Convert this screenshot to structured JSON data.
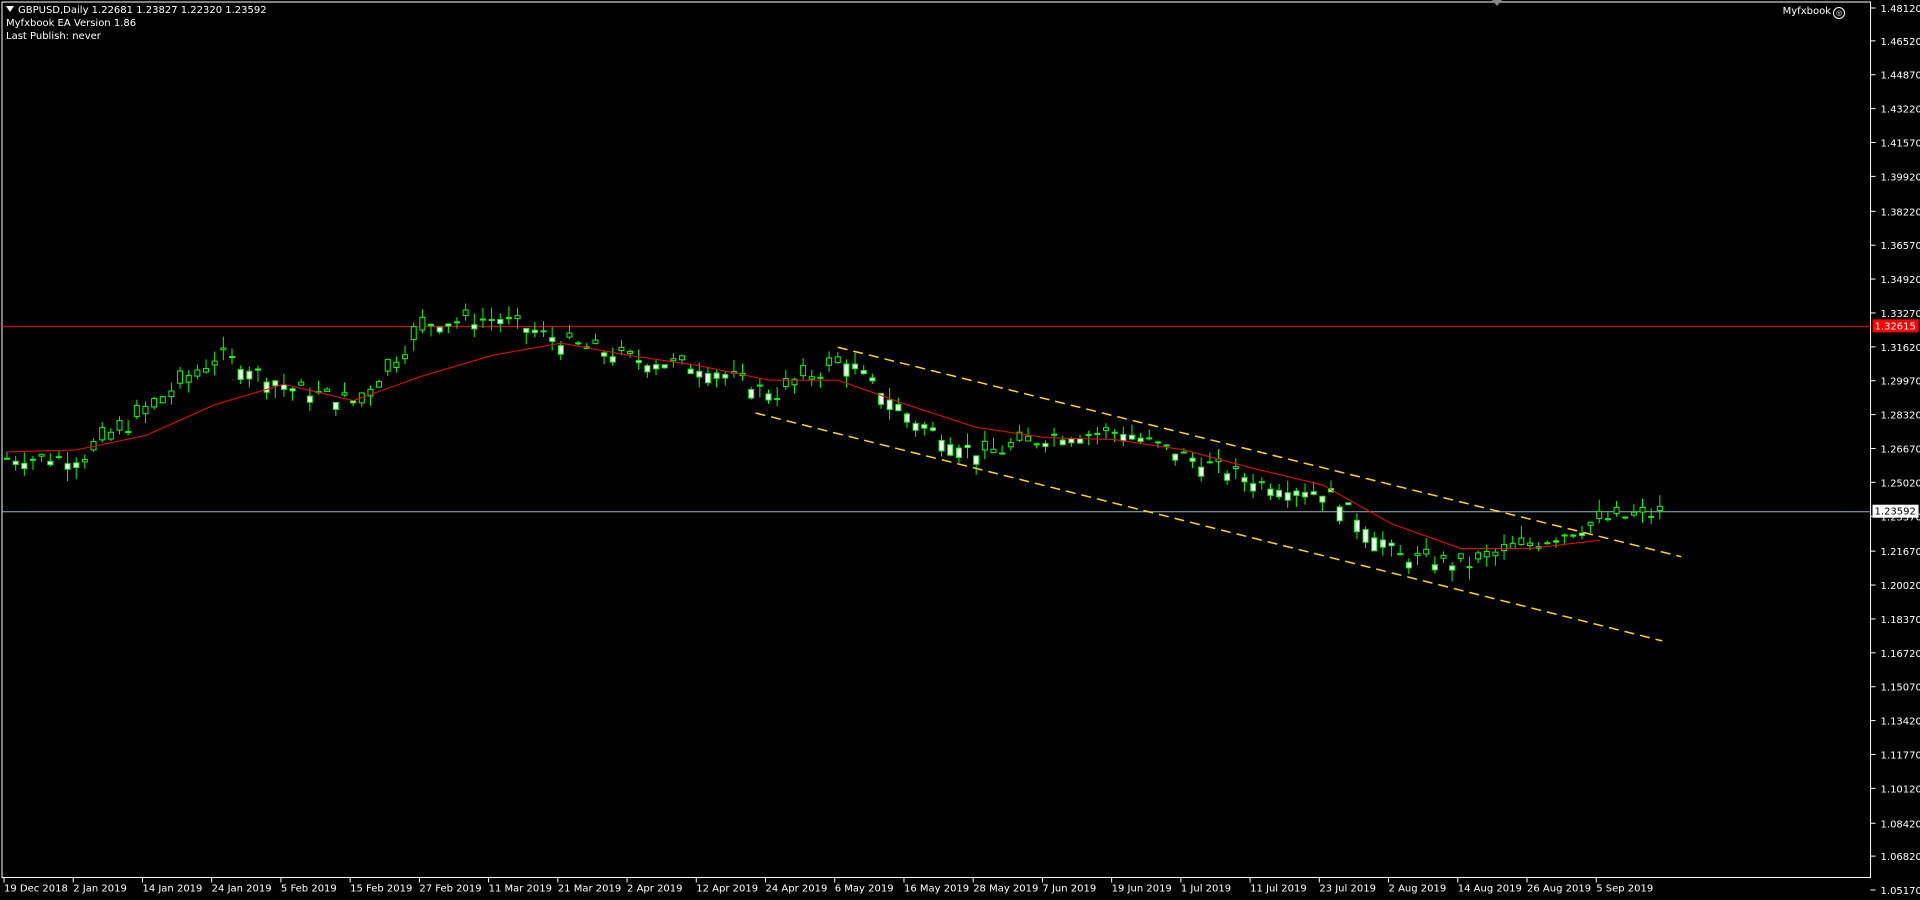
{
  "header": {
    "symbol_line": "GBPUSD,Daily  1.22681 1.23827 1.22320 1.23592",
    "ea_version": "Myfxbook EA Version 1.86",
    "last_publish": "Last Publish: never",
    "brand": "Myfxbook",
    "brand_icon": "myfxbook-logo-icon"
  },
  "colors": {
    "background": "#000000",
    "bull_candle": "#00ff00",
    "ma_line": "#ff0000",
    "channel_lines": "#ffd700",
    "resistance_line": "#ff0000",
    "bid_line": "#8fb8cc",
    "axis": "#ffffff"
  },
  "chart_data": {
    "type": "candlestick",
    "title": "GBPUSD,Daily",
    "ylim": [
      1.0517,
      1.4812
    ],
    "y_ticks": [
      "1.48120",
      "1.46520",
      "1.44870",
      "1.43220",
      "1.41570",
      "1.39920",
      "1.38220",
      "1.36570",
      "1.34920",
      "1.33270",
      "1.31620",
      "1.29970",
      "1.28320",
      "1.26670",
      "1.25020",
      "1.23370",
      "1.21670",
      "1.20020",
      "1.18370",
      "1.16720",
      "1.15070",
      "1.13420",
      "1.11770",
      "1.10120",
      "1.08420",
      "1.06820",
      "1.05170"
    ],
    "x_ticks": [
      "19 Dec 2018",
      "2 Jan 2019",
      "14 Jan 2019",
      "24 Jan 2019",
      "5 Feb 2019",
      "15 Feb 2019",
      "27 Feb 2019",
      "11 Mar 2019",
      "21 Mar 2019",
      "2 Apr 2019",
      "12 Apr 2019",
      "24 Apr 2019",
      "6 May 2019",
      "16 May 2019",
      "28 May 2019",
      "7 Jun 2019",
      "19 Jun 2019",
      "1 Jul 2019",
      "11 Jul 2019",
      "23 Jul 2019",
      "2 Aug 2019",
      "14 Aug 2019",
      "26 Aug 2019",
      "5 Sep 2019"
    ],
    "horizontal_lines": [
      {
        "value": 1.32615,
        "label": "1.32615",
        "color": "#ff0000"
      },
      {
        "value": 1.23592,
        "label": "1.23592",
        "color": "#8fb8cc"
      }
    ],
    "close_series": [
      {
        "date": "19 Dec 2018",
        "close": 1.262
      },
      {
        "date": "2 Jan 2019",
        "close": 1.262
      },
      {
        "date": "14 Jan 2019",
        "close": 1.286
      },
      {
        "date": "24 Jan 2019",
        "close": 1.312
      },
      {
        "date": "5 Feb 2019",
        "close": 1.296
      },
      {
        "date": "15 Feb 2019",
        "close": 1.289
      },
      {
        "date": "27 Feb 2019",
        "close": 1.328
      },
      {
        "date": "11 Mar 2019",
        "close": 1.33
      },
      {
        "date": "21 Mar 2019",
        "close": 1.318
      },
      {
        "date": "2 Apr 2019",
        "close": 1.31
      },
      {
        "date": "12 Apr 2019",
        "close": 1.306
      },
      {
        "date": "24 Apr 2019",
        "close": 1.293
      },
      {
        "date": "6 May 2019",
        "close": 1.31
      },
      {
        "date": "16 May 2019",
        "close": 1.28
      },
      {
        "date": "28 May 2019",
        "close": 1.263
      },
      {
        "date": "7 Jun 2019",
        "close": 1.273
      },
      {
        "date": "19 Jun 2019",
        "close": 1.275
      },
      {
        "date": "1 Jul 2019",
        "close": 1.262
      },
      {
        "date": "11 Jul 2019",
        "close": 1.25
      },
      {
        "date": "23 Jul 2019",
        "close": 1.245
      },
      {
        "date": "2 Aug 2019",
        "close": 1.214
      },
      {
        "date": "14 Aug 2019",
        "close": 1.21
      },
      {
        "date": "26 Aug 2019",
        "close": 1.221
      },
      {
        "date": "5 Sep 2019",
        "close": 1.232
      },
      {
        "date": "",
        "close": 1.236
      }
    ],
    "moving_average": [
      {
        "date": "19 Dec 2018",
        "value": 1.265
      },
      {
        "date": "2 Jan 2019",
        "value": 1.266
      },
      {
        "date": "14 Jan 2019",
        "value": 1.273
      },
      {
        "date": "24 Jan 2019",
        "value": 1.288
      },
      {
        "date": "5 Feb 2019",
        "value": 1.298
      },
      {
        "date": "15 Feb 2019",
        "value": 1.29
      },
      {
        "date": "27 Feb 2019",
        "value": 1.302
      },
      {
        "date": "11 Mar 2019",
        "value": 1.312
      },
      {
        "date": "21 Mar 2019",
        "value": 1.318
      },
      {
        "date": "2 Apr 2019",
        "value": 1.312
      },
      {
        "date": "12 Apr 2019",
        "value": 1.307
      },
      {
        "date": "24 Apr 2019",
        "value": 1.3
      },
      {
        "date": "6 May 2019",
        "value": 1.3
      },
      {
        "date": "16 May 2019",
        "value": 1.288
      },
      {
        "date": "28 May 2019",
        "value": 1.277
      },
      {
        "date": "7 Jun 2019",
        "value": 1.272
      },
      {
        "date": "19 Jun 2019",
        "value": 1.271
      },
      {
        "date": "1 Jul 2019",
        "value": 1.266
      },
      {
        "date": "11 Jul 2019",
        "value": 1.257
      },
      {
        "date": "23 Jul 2019",
        "value": 1.249
      },
      {
        "date": "2 Aug 2019",
        "value": 1.23
      },
      {
        "date": "14 Aug 2019",
        "value": 1.218
      },
      {
        "date": "26 Aug 2019",
        "value": 1.218
      },
      {
        "date": "5 Sep 2019",
        "value": 1.222
      }
    ],
    "trend_channel": {
      "upper": [
        {
          "date": "6 May 2019",
          "value": 1.316
        },
        {
          "date": "",
          "value": 1.214
        }
      ],
      "lower": [
        {
          "date": "24 Apr 2019",
          "value": 1.284
        },
        {
          "date": "",
          "value": 1.173
        }
      ]
    }
  }
}
